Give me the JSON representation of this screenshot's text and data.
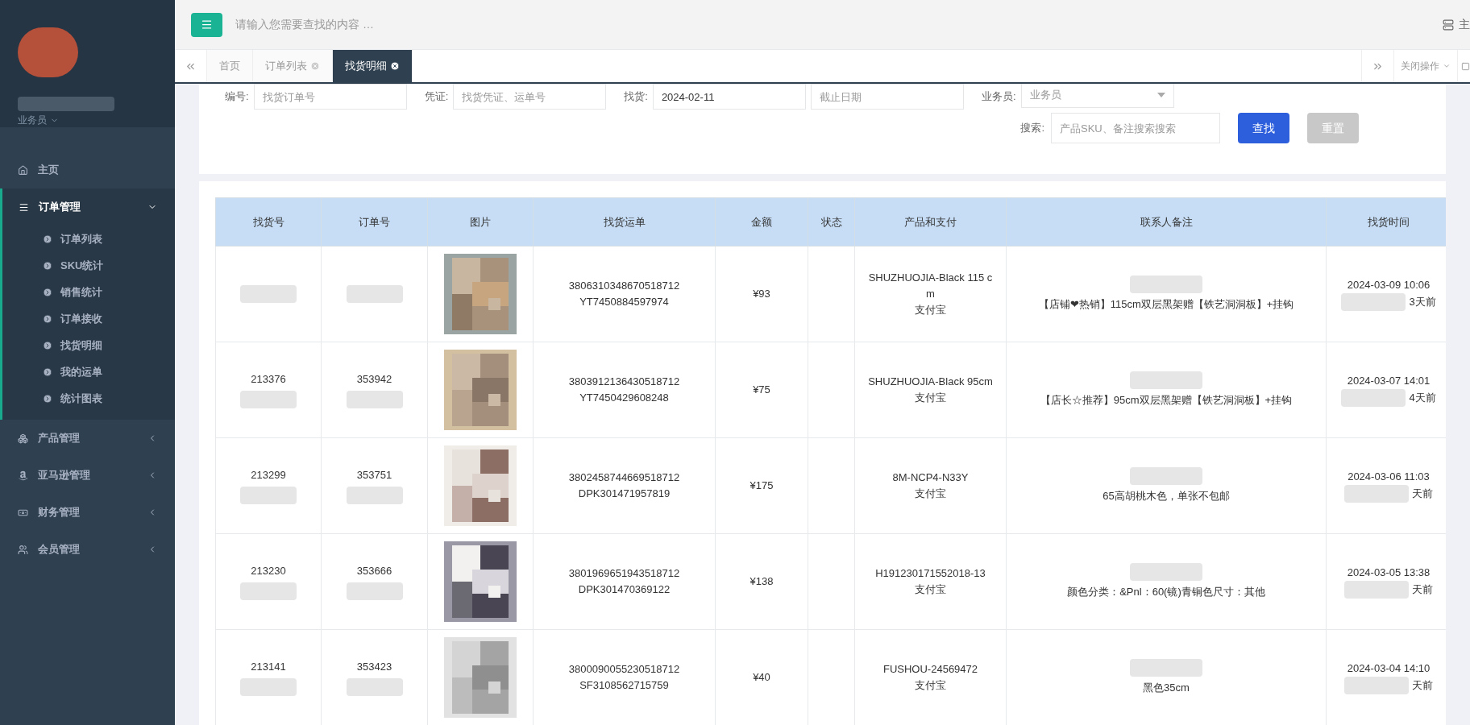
{
  "sidebar": {
    "user_role": "业务员",
    "nav": [
      {
        "label": "主页",
        "expanded": false
      },
      {
        "label": "订单管理",
        "expanded": true,
        "children": [
          {
            "label": "订单列表"
          },
          {
            "label": "SKU统计"
          },
          {
            "label": "销售统计"
          },
          {
            "label": "订单接收"
          },
          {
            "label": "找货明细"
          },
          {
            "label": "我的运单"
          },
          {
            "label": "统计图表"
          }
        ]
      },
      {
        "label": "产品管理",
        "expanded": false
      },
      {
        "label": "亚马逊管理",
        "expanded": false
      },
      {
        "label": "财务管理",
        "expanded": false
      },
      {
        "label": "会员管理",
        "expanded": false
      }
    ]
  },
  "topbar": {
    "search": {
      "placeholder": "请输入您需要查找的内容 …"
    },
    "right_label": "主"
  },
  "tabs": [
    {
      "label": "首页",
      "closable": false,
      "selected": false
    },
    {
      "label": "订单列表",
      "closable": true,
      "selected": false
    },
    {
      "label": "找货明细",
      "closable": true,
      "selected": true
    }
  ],
  "tab_actions": {
    "close_menu": "关闭操作"
  },
  "filters": {
    "row_1": [
      {
        "label": "编号:",
        "fields": [
          {
            "placeholder": "找货订单号"
          }
        ]
      },
      {
        "label": "凭证:",
        "fields": [
          {
            "placeholder": "找货凭证、运单号"
          }
        ]
      },
      {
        "label": "找货:",
        "fields": [
          {
            "value": "2024-02-11"
          },
          {
            "placeholder": "截止日期"
          }
        ]
      },
      {
        "label": "业务员:",
        "select": "业务员"
      }
    ],
    "search": {
      "label": "搜索:",
      "placeholder": "产品SKU、备注搜索搜索"
    },
    "buttons": [
      {
        "label": "查找",
        "kind": "primary"
      },
      {
        "label": "重置",
        "kind": "muted"
      }
    ]
  },
  "table": {
    "columns": [
      "找货号",
      "订单号",
      "图片",
      "找货运单",
      "金额",
      "状态",
      "产品和支付",
      "联系人备注",
      "找货时间"
    ],
    "rows": [
      {
        "find_no": "",
        "order_no": "",
        "waybill": [
          "3806310348670518712",
          "YT7450884597974"
        ],
        "amount": "¥93",
        "product": "SHUZHUOJIA-Black 115 cm",
        "payment": "支付宝",
        "note": "【店铺❤热销】115cm双层黑架赠【铁艺洞洞板】+挂钩",
        "time": "2024-03-09 10:06",
        "ago": "3天前"
      },
      {
        "find_no": "213376",
        "order_no": "353942",
        "waybill": [
          "3803912136430518712",
          "YT7450429608248"
        ],
        "amount": "¥75",
        "product": "SHUZHUOJIA-Black 95cm",
        "payment": "支付宝",
        "note": "【店长☆推荐】95cm双层黑架赠【铁艺洞洞板】+挂钩",
        "time": "2024-03-07 14:01",
        "ago": "4天前"
      },
      {
        "find_no": "213299",
        "order_no": "353751",
        "waybill": [
          "3802458744669518712",
          "DPK301471957819"
        ],
        "amount": "¥175",
        "product": "8M-NCP4-N33Y",
        "payment": "支付宝",
        "note": "65高胡桃木色，单张不包邮",
        "time": "2024-03-06 11:03",
        "ago": "天前"
      },
      {
        "find_no": "213230",
        "order_no": "353666",
        "waybill": [
          "3801969651943518712",
          "DPK301470369122"
        ],
        "amount": "¥138",
        "product": "H191230171552018-13",
        "payment": "支付宝",
        "note": "颜色分类：&Pnl：60(镜)青铜色尺寸：其他",
        "time": "2024-03-05 13:38",
        "ago": "天前"
      },
      {
        "find_no": "213141",
        "order_no": "353423",
        "waybill": [
          "3800090055230518712",
          "SF3108562715759"
        ],
        "amount": "¥40",
        "product": "FUSHOU-24569472",
        "payment": "支付宝",
        "note": "黑色35cm",
        "time": "2024-03-04 14:10",
        "ago": "天前"
      }
    ]
  }
}
